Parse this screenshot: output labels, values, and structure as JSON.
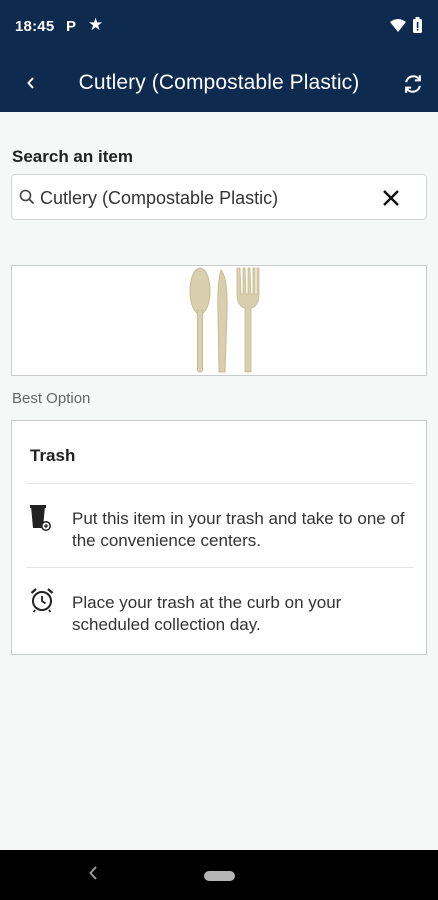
{
  "status_bar": {
    "time": "18:45",
    "p_icon": "P",
    "star_icon": "★",
    "icons": [
      "parking-notification-icon",
      "star-notification-icon",
      "wifi-icon",
      "battery-icon"
    ]
  },
  "app_bar": {
    "title": "Cutlery (Compostable Plastic)",
    "back_icon": "chevron-left-icon",
    "refresh_icon": "refresh-icon"
  },
  "search": {
    "label": "Search an item",
    "value": "Cutlery (Compostable Plastic)",
    "placeholder": "Search an item",
    "clear_icon": "close-icon"
  },
  "item_image": {
    "icon": "cutlery-icon"
  },
  "best_option_label": "Best Option",
  "option": {
    "title": "Trash",
    "steps": [
      {
        "icon": "trash-can-icon",
        "text": "Put this item in your trash and take to one of the convenience centers."
      },
      {
        "icon": "alarm-clock-icon",
        "text": "Place your trash at the curb on your scheduled collection day."
      }
    ]
  },
  "colors": {
    "header": "#0e2a4f",
    "background": "#f6f7f7",
    "card": "#ffffff",
    "border": "#c9cccf",
    "cutlery": "#d9cfae"
  },
  "nav_bar": {
    "icons": [
      "nav-back-icon",
      "nav-home-pill"
    ]
  }
}
